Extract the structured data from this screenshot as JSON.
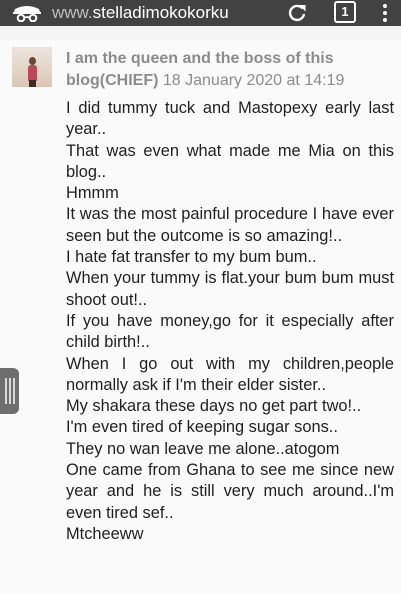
{
  "browser": {
    "url_prefix": "www.",
    "url_host": "stelladimokokorku",
    "tab_count": "1",
    "icons": {
      "incognito": "incognito-icon",
      "reload": "reload-icon",
      "menu": "more-vert-icon"
    },
    "colors": {
      "toolbar": "#424242",
      "toolbar_text": "#ffffff"
    }
  },
  "comment": {
    "author": "I am the queen and the boss of this blog(CHIEF)",
    "date": "18 January 2020 at 14:19",
    "body_lines": [
      "I did tummy tuck and Mastopexy early last year..",
      "That was even what made me Mia on this blog..",
      "Hmmm",
      "It was the most painful procedure I have ever seen but the outcome is so amazing!..",
      "I hate fat transfer to my bum bum..",
      "When your tummy is flat.your bum bum must shoot out!..",
      "If you have money,go for it especially after child birth!..",
      "When I go out with my children,people normally ask if I'm their elder sister..",
      "My shakara these days no get part two!..",
      "I'm even tired of keeping sugar sons..",
      "They no wan leave me alone..atogom",
      "One came from Ghana to see me since new year and he is still very much around..I'm even tired sef..",
      "Mtcheeww"
    ]
  }
}
